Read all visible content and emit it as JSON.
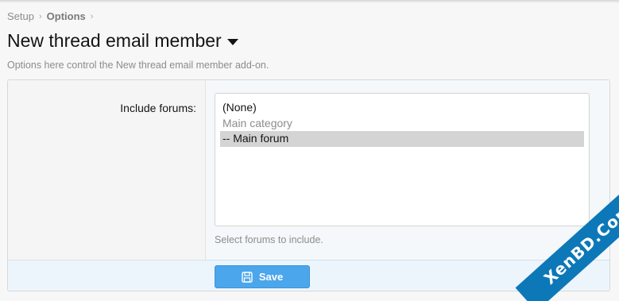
{
  "breadcrumb": {
    "items": [
      "Setup",
      "Options"
    ],
    "separator": "›"
  },
  "header": {
    "title": "New thread email member",
    "description": "Options here control the New thread email member add-on."
  },
  "form": {
    "include_forums": {
      "label": "Include forums:",
      "options": [
        "(None)",
        "Main category",
        "-- Main forum"
      ],
      "selected": "-- Main forum",
      "hint": "Select forums to include."
    },
    "save_label": "Save"
  },
  "watermark": "XenBD.Com",
  "colors": {
    "accent": "#4ba6ec",
    "footer_bg": "#edf5fc",
    "watermark_bg": "#0d78b8"
  }
}
